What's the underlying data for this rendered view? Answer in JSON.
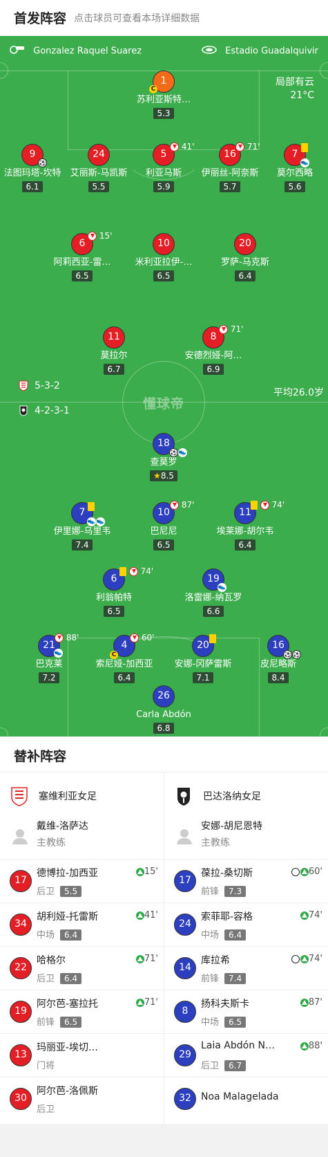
{
  "header": {
    "title": "首发阵容",
    "subtitle": "点击球员可查看本场详细数据"
  },
  "pitch": {
    "referee": "Gonzalez Raquel Suarez",
    "stadium": "Estadio Guadalquivir",
    "weather": "局部有云",
    "temperature": "21°C",
    "home_formation": "5-3-2",
    "away_formation": "4-2-3-1",
    "avg_age": "平均26.0岁",
    "watermark": "懂球帝"
  },
  "home_players": [
    {
      "num": "1",
      "name": "苏利亚斯特…",
      "rating": "5.3",
      "captain": "C"
    },
    {
      "num": "9",
      "name": "法图玛塔-坎特",
      "rating": "6.1"
    },
    {
      "num": "24",
      "name": "艾丽斯-马凯斯",
      "rating": "5.5"
    },
    {
      "num": "5",
      "name": "利亚马斯",
      "rating": "5.9",
      "sub_min": "41'"
    },
    {
      "num": "16",
      "name": "伊丽丝-阿奈斯",
      "rating": "5.7",
      "sub_min": "71'"
    },
    {
      "num": "7",
      "name": "莫尔西略",
      "rating": "5.6"
    },
    {
      "num": "6",
      "name": "阿莉西亚-雷…",
      "rating": "6.5",
      "sub_min": "15'"
    },
    {
      "num": "10",
      "name": "米利亚拉伊-…",
      "rating": "6.5"
    },
    {
      "num": "20",
      "name": "罗萨-马克斯",
      "rating": "6.4"
    },
    {
      "num": "11",
      "name": "莫拉尔",
      "rating": "6.7"
    },
    {
      "num": "8",
      "name": "安德烈娅-阿…",
      "rating": "6.9",
      "sub_min": "71'"
    }
  ],
  "away_players": [
    {
      "num": "18",
      "name": "查莫罗",
      "rating": "8.5"
    },
    {
      "num": "7",
      "name": "伊里娜-乌里韦",
      "rating": "7.4"
    },
    {
      "num": "10",
      "name": "巴尼尼",
      "rating": "6.5",
      "sub_min": "87'"
    },
    {
      "num": "11",
      "name": "埃莱娜-胡尔韦",
      "rating": "6.4",
      "sub_min": "74'"
    },
    {
      "num": "6",
      "name": "利翁帕特",
      "rating": "6.5",
      "sub_min": "74'"
    },
    {
      "num": "19",
      "name": "洛雷娜-纳瓦罗",
      "rating": "6.6"
    },
    {
      "num": "21",
      "name": "巴克莱",
      "rating": "7.2",
      "sub_min": "88'"
    },
    {
      "num": "4",
      "name": "索尼娅-加西亚",
      "rating": "6.4",
      "sub_min": "60'",
      "captain": "C"
    },
    {
      "num": "20",
      "name": "安娜-冈萨雷斯",
      "rating": "7.1"
    },
    {
      "num": "16",
      "name": "皮尼略斯",
      "rating": "8.4"
    },
    {
      "num": "26",
      "name": "Carla Abdón",
      "rating": "6.8"
    }
  ],
  "subs": {
    "title": "替补阵容",
    "home": {
      "team": "塞维利亚女足",
      "coach": "戴维-洛萨达",
      "coach_role": "主教练",
      "players": [
        {
          "num": "17",
          "name": "德博拉-加西亚",
          "pos": "后卫",
          "rating": "5.5",
          "min": "15'"
        },
        {
          "num": "34",
          "name": "胡利娅-托雷斯",
          "pos": "中场",
          "rating": "6.4",
          "min": "41'"
        },
        {
          "num": "22",
          "name": "哈格尔",
          "pos": "后卫",
          "rating": "6.4",
          "min": "71'"
        },
        {
          "num": "19",
          "name": "阿尔芭-塞拉托",
          "pos": "前锋",
          "rating": "6.5",
          "min": "71'"
        },
        {
          "num": "13",
          "name": "玛丽亚-埃切…",
          "pos": "门将",
          "rating": "",
          "min": ""
        },
        {
          "num": "30",
          "name": "阿尔芭-洛佩斯",
          "pos": "后卫",
          "rating": "",
          "min": ""
        }
      ]
    },
    "away": {
      "team": "巴达洛纳女足",
      "coach": "安娜-胡尼恩特",
      "coach_role": "主教练",
      "players": [
        {
          "num": "17",
          "name": "葆拉-桑切斯",
          "pos": "前锋",
          "rating": "7.3",
          "min": "60'",
          "goal": true
        },
        {
          "num": "24",
          "name": "索菲耶-容格",
          "pos": "中场",
          "rating": "6.4",
          "min": "74'"
        },
        {
          "num": "14",
          "name": "库拉希",
          "pos": "前锋",
          "rating": "7.4",
          "min": "74'",
          "goal": true
        },
        {
          "num": "8",
          "name": "扬科夫斯卡",
          "pos": "中场",
          "rating": "6.5",
          "min": "87'"
        },
        {
          "num": "29",
          "name": "Laia Abdón N…",
          "pos": "后卫",
          "rating": "6.7",
          "min": "88'"
        },
        {
          "num": "32",
          "name": "Noa Malagelada",
          "pos": "",
          "rating": "",
          "min": ""
        }
      ]
    }
  }
}
